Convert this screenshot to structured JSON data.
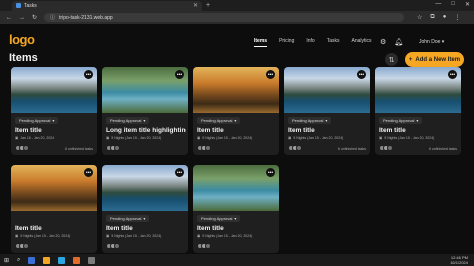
{
  "browser": {
    "tab_title": "Tasks",
    "url": "tripo-task-2131.web.app",
    "win_controls": [
      "—",
      "□",
      "✕"
    ]
  },
  "app": {
    "logo": "logo",
    "page_title": "Items",
    "nav": [
      "Items",
      "Pricing",
      "Info",
      "Tasks",
      "Analytics"
    ],
    "user": "John Doe",
    "add_button": "Add a New Item",
    "add_icon": "plus-icon",
    "filter_icon": "filter-icon"
  },
  "cards": [
    {
      "status": "Pending Approval",
      "title": "Item title",
      "dates": "Jan 16 - Jan 20, 2024",
      "tasks": "6 unfinished tasks",
      "img": "a"
    },
    {
      "status": "Pending Approval",
      "title": "Long item title highlighting ...",
      "dates": "5 Nights (Jan 15 - Jan 20, 2024)",
      "tasks": "",
      "img": "b"
    },
    {
      "status": "Pending Approval",
      "title": "Item title",
      "dates": "5 Nights (Jan 15 - Jan 20, 2024)",
      "tasks": "",
      "img": "c"
    },
    {
      "status": "Pending Approval",
      "title": "Item title",
      "dates": "5 Nights (Jan 15 - Jan 20, 2024)",
      "tasks": "6 unfinished tasks",
      "img": "a"
    },
    {
      "status": "Pending Approval",
      "title": "Item title",
      "dates": "5 Nights (Jan 15 - Jan 20, 2024)",
      "tasks": "6 unfinished tasks",
      "img": "a"
    },
    {
      "status": "",
      "title": "Item title",
      "dates": "5 Nights (Jan 15 - Jan 20, 2024)",
      "tasks": "",
      "img": "c"
    },
    {
      "status": "Pending Approval",
      "title": "Item title",
      "dates": "5 Nights (Jan 15 - Jan 20, 2024)",
      "tasks": "",
      "img": "a"
    },
    {
      "status": "Pending Approval",
      "title": "Item title",
      "dates": "5 Nights (Jan 15 - Jan 20, 2024)",
      "tasks": "",
      "img": "b"
    }
  ],
  "taskbar": {
    "time": "12:46 PM",
    "date": "16/1/2024"
  },
  "colors": {
    "accent": "#f5a623"
  }
}
